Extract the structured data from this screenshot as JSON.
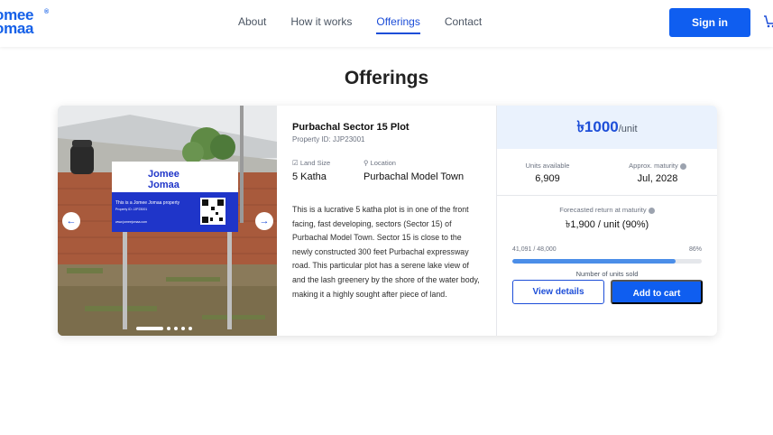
{
  "brand": {
    "line1": "omee",
    "line2": "omaa",
    "mark": "®",
    "color": "#1560e8"
  },
  "nav": {
    "items": [
      {
        "label": "About"
      },
      {
        "label": "How it works"
      },
      {
        "label": "Offerings",
        "active": true
      },
      {
        "label": "Contact"
      }
    ],
    "signin_label": "Sign in",
    "cart_icon": "cart-icon"
  },
  "page": {
    "title": "Offerings"
  },
  "listing": {
    "photo": {
      "sign_brand_line1": "Jomee",
      "sign_brand_line2": "Jomaa",
      "sign_text": "This is a Jomee Jomaa property",
      "sign_property": "Property ID: JJP23001",
      "sign_web": "www.jomeejomaa.com",
      "prev_icon": "arrow-left-icon",
      "next_icon": "arrow-right-icon",
      "slide_count": 5,
      "active_slide": 1
    },
    "title": "Purbachal Sector 15 Plot",
    "property_id": "Property ID: JJP23001",
    "land_size_label": "Land Size",
    "land_size_value": "5 Katha",
    "location_label": "Location",
    "location_value": "Purbachal Model Town",
    "description": "This is a lucrative 5 katha plot is in one of the front facing, fast developing, sectors (Sector 15) of Purbachal Model Town. Sector 15 is close to the newly constructed 300 feet Purbachal expressway road. This particular plot has a serene lake view of and the lash greenery by the shore of the water body, making it a highly sought after piece of land."
  },
  "pricing": {
    "price": "৳1000",
    "unit": "/unit",
    "units_available_label": "Units available",
    "units_available_value": "6,909",
    "maturity_label": "Approx. maturity",
    "maturity_value": "Jul, 2028",
    "forecast_label": "Forecasted return at maturity",
    "forecast_value": "৳1,900 / unit (90%)",
    "sold_text": "41,091 / 48,000",
    "sold_percent_text": "86%",
    "sold_fraction": 0.86,
    "sold_caption": "Number of units sold",
    "view_details_label": "View details",
    "add_to_cart_label": "Add to cart",
    "accent_color": "#0f5ef0"
  }
}
